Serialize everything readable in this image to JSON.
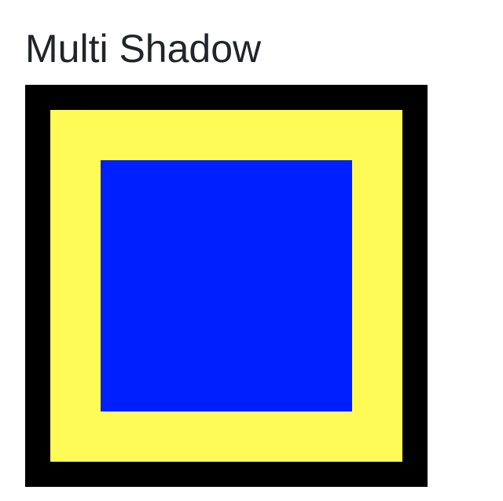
{
  "header": {
    "title": "Multi Shadow"
  },
  "colors": {
    "outer_border": "#000000",
    "middle_shadow": "#fffb56",
    "inner_box": "#001fff",
    "text": "#212529"
  }
}
